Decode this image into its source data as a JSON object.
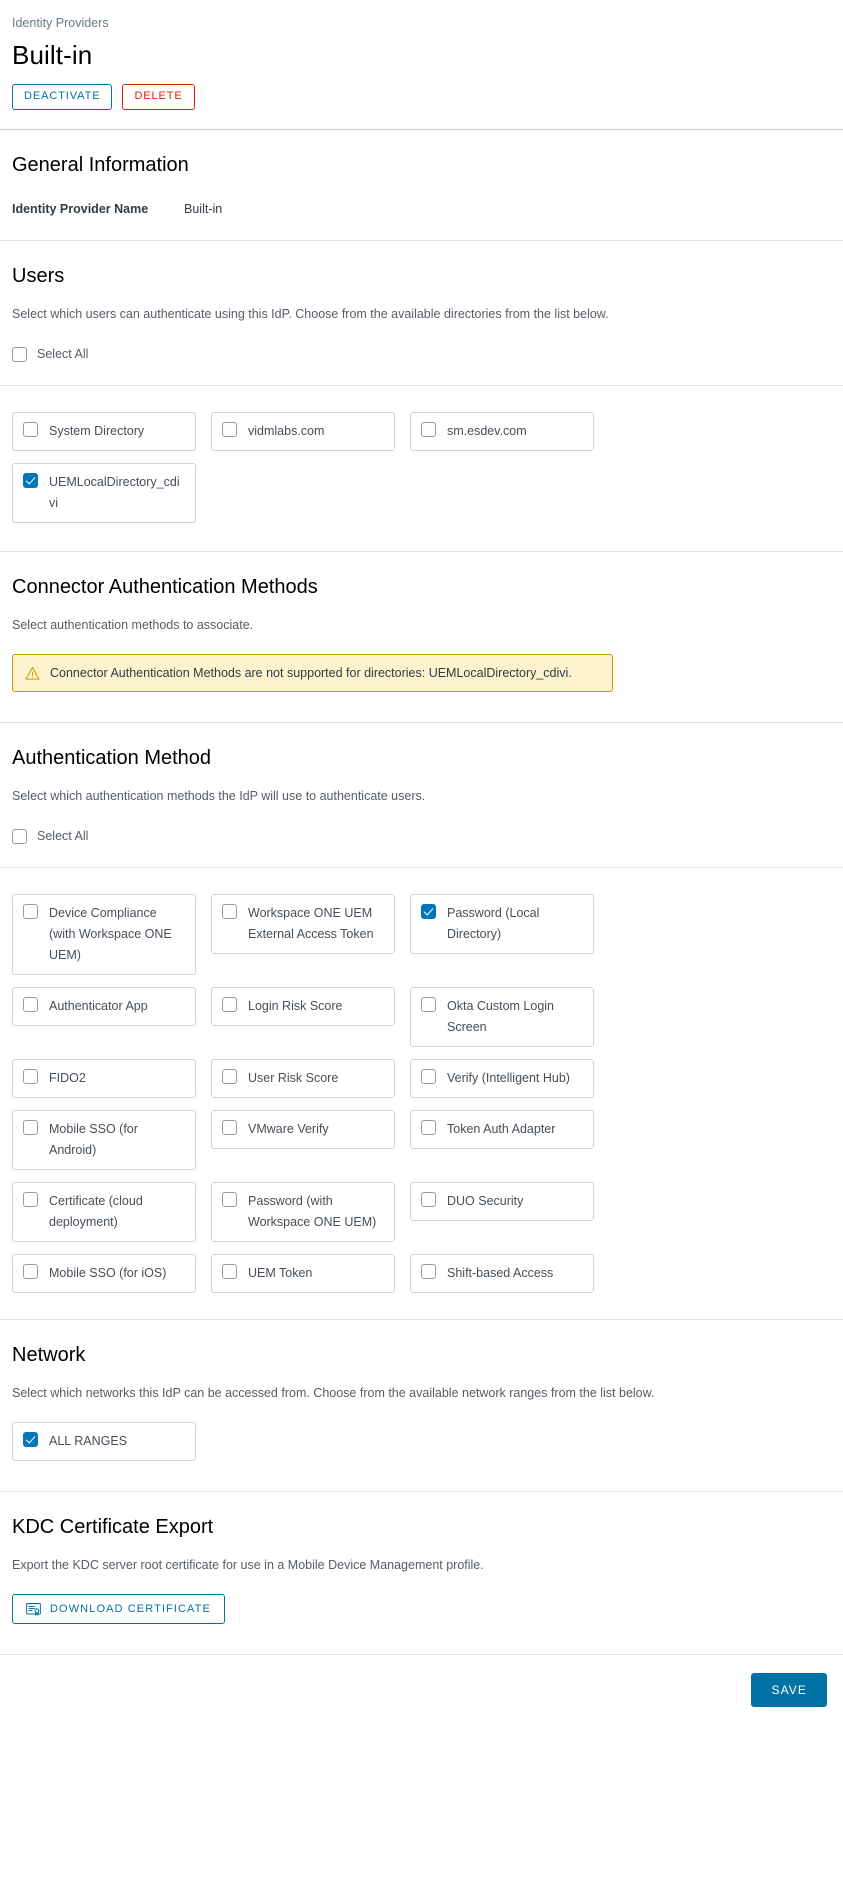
{
  "header": {
    "breadcrumb": "Identity Providers",
    "title": "Built-in",
    "deactivate_label": "DEACTIVATE",
    "delete_label": "DELETE"
  },
  "general": {
    "title": "General Information",
    "name_label": "Identity Provider Name",
    "name_value": "Built-in"
  },
  "users": {
    "title": "Users",
    "description": "Select which users can authenticate using this IdP. Choose from the available directories from the list below.",
    "select_all_label": "Select All",
    "select_all_checked": false,
    "directories": [
      {
        "label": "System Directory",
        "checked": false
      },
      {
        "label": "vidmlabs.com",
        "checked": false
      },
      {
        "label": "sm.esdev.com",
        "checked": false
      },
      {
        "label": "UEMLocalDirectory_cdivi",
        "checked": true
      }
    ]
  },
  "connector_auth": {
    "title": "Connector Authentication Methods",
    "description": "Select authentication methods to associate.",
    "alert_text": "Connector Authentication Methods are not supported for directories: UEMLocalDirectory_cdivi.",
    "alert_icon": "warning-triangle-icon",
    "alert_bg": "#fdf3ce",
    "alert_border": "#cd9b00"
  },
  "auth_method": {
    "title": "Authentication Method",
    "description": "Select which authentication methods the IdP will use to authenticate users.",
    "select_all_label": "Select All",
    "select_all_checked": false,
    "methods": [
      {
        "label": "Device Compliance (with Workspace ONE UEM)",
        "checked": false
      },
      {
        "label": "Workspace ONE UEM External Access Token",
        "checked": false
      },
      {
        "label": "Password (Local Directory)",
        "checked": true
      },
      {
        "label": "Authenticator App",
        "checked": false
      },
      {
        "label": "Login Risk Score",
        "checked": false
      },
      {
        "label": "Okta Custom Login Screen",
        "checked": false
      },
      {
        "label": "FIDO2",
        "checked": false
      },
      {
        "label": "User Risk Score",
        "checked": false
      },
      {
        "label": "Verify (Intelligent Hub)",
        "checked": false
      },
      {
        "label": "Mobile SSO (for Android)",
        "checked": false
      },
      {
        "label": "VMware Verify",
        "checked": false
      },
      {
        "label": "Token Auth Adapter",
        "checked": false
      },
      {
        "label": "Certificate (cloud deployment)",
        "checked": false
      },
      {
        "label": "Password (with Workspace ONE UEM)",
        "checked": false
      },
      {
        "label": "DUO Security",
        "checked": false
      },
      {
        "label": "Mobile SSO (for iOS)",
        "checked": false
      },
      {
        "label": "UEM Token",
        "checked": false
      },
      {
        "label": "Shift-based Access",
        "checked": false
      }
    ]
  },
  "network": {
    "title": "Network",
    "description": "Select which networks this IdP can be accessed from. Choose from the available network ranges from the list below.",
    "ranges": [
      {
        "label": "ALL RANGES",
        "checked": true
      }
    ]
  },
  "kdc": {
    "title": "KDC Certificate Export",
    "description": "Export the KDC server root certificate for use in a Mobile Device Management profile.",
    "download_label": "DOWNLOAD CERTIFICATE",
    "download_icon": "certificate-icon"
  },
  "footer": {
    "save_label": "SAVE"
  },
  "colors": {
    "accent": "#0072a3",
    "danger": "#e02200",
    "checkbox_checked": "#0077b8",
    "text": "#313b42",
    "muted": "#565d64"
  }
}
